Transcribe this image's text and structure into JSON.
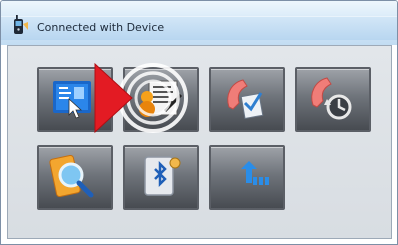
{
  "window": {
    "title": "Connected with Device",
    "title_icon": "phone-icon"
  },
  "tiles": [
    {
      "name": "sync-contacts-tile",
      "icon": "contacts-sync-icon"
    },
    {
      "name": "business-card-tile",
      "icon": "business-card-icon"
    },
    {
      "name": "call-log-tile",
      "icon": "call-log-icon"
    },
    {
      "name": "call-restore-tile",
      "icon": "call-restore-icon"
    },
    {
      "name": "phone-search-tile",
      "icon": "phone-search-icon"
    },
    {
      "name": "bluetooth-settings-tile",
      "icon": "bluetooth-icon"
    },
    {
      "name": "upload-tile",
      "icon": "upload-icon"
    }
  ],
  "colors": {
    "title_bar": "#c2dcf2",
    "panel": "#dcE0E4",
    "tile_dark": "#474b51",
    "pointer": "#e31b23"
  }
}
